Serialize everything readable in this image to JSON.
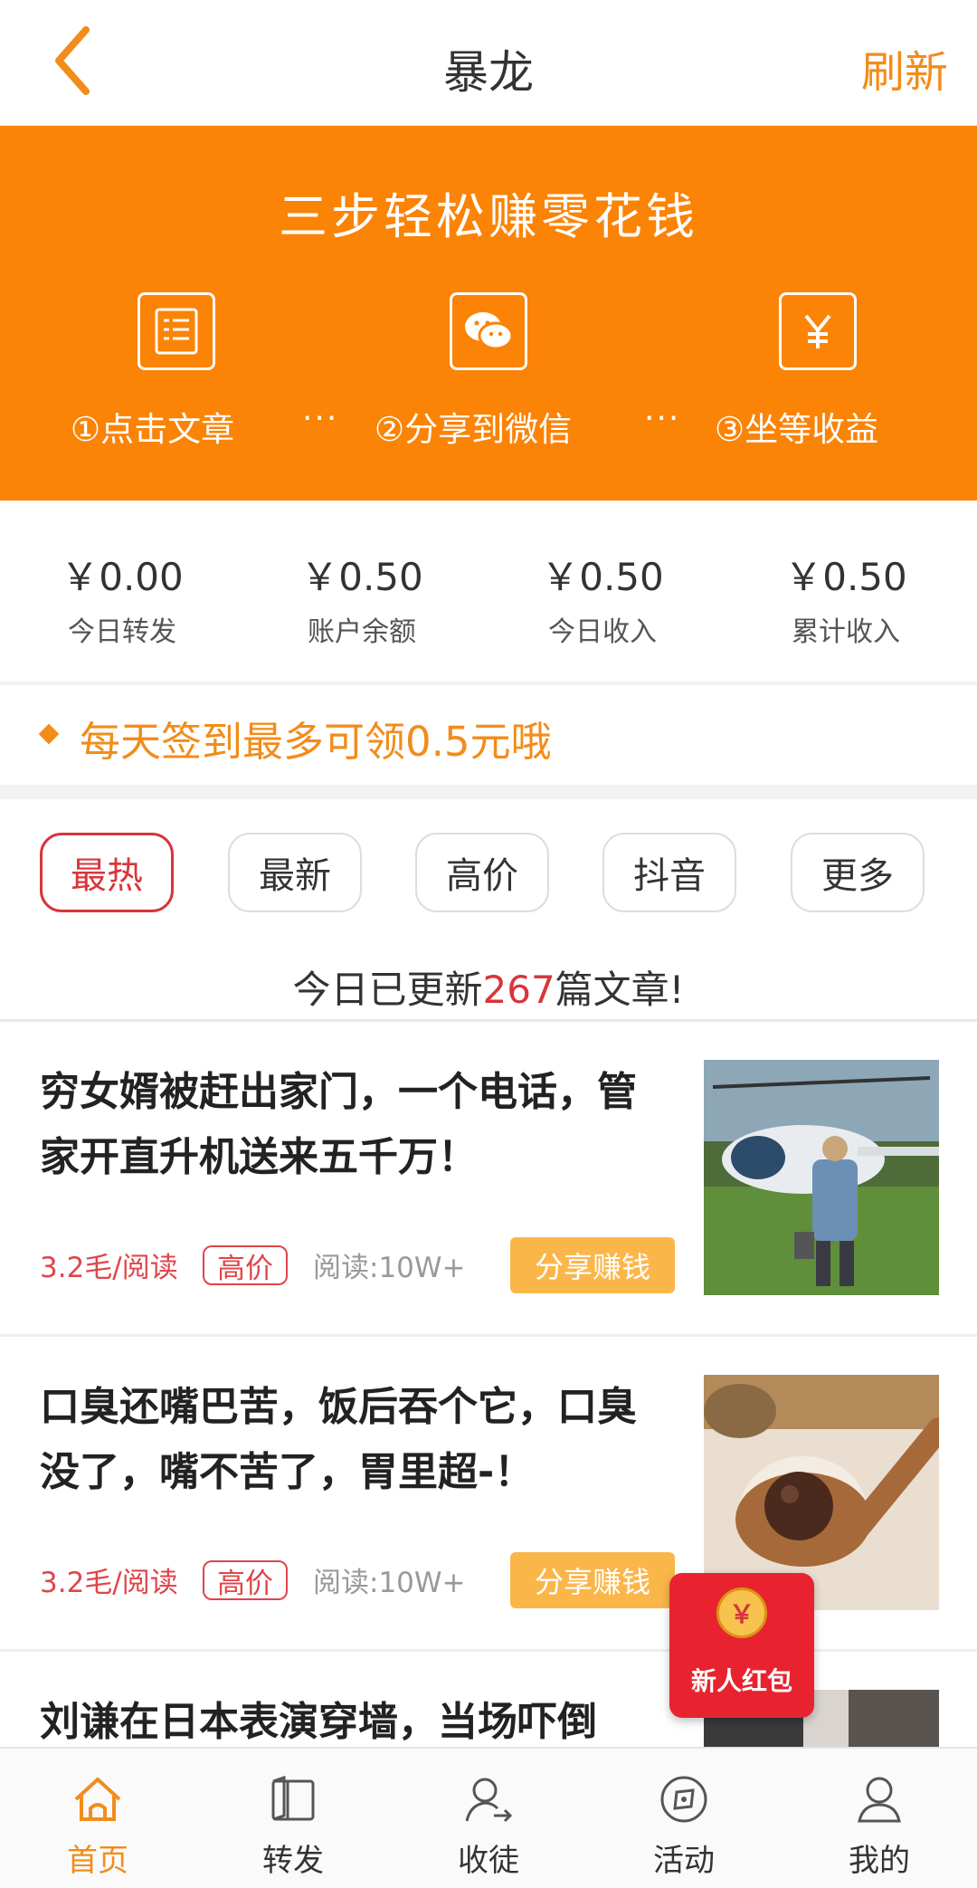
{
  "header": {
    "title": "暴龙",
    "refresh_label": "刷新"
  },
  "banner": {
    "title": "三步轻松赚零花钱",
    "steps": [
      {
        "label": "①点击文章",
        "icon": "article-list-icon"
      },
      {
        "label": "②分享到微信",
        "icon": "wechat-icon"
      },
      {
        "label": "③坐等收益",
        "icon": "yuan-icon"
      }
    ],
    "dots": "···"
  },
  "stats": [
    {
      "value": "￥0.00",
      "label": "今日转发"
    },
    {
      "value": "￥0.50",
      "label": "账户余额"
    },
    {
      "value": "￥0.50",
      "label": "今日收入"
    },
    {
      "value": "￥0.50",
      "label": "累计收入"
    }
  ],
  "tip": {
    "text": "每天签到最多可领0.5元哦"
  },
  "tabs": [
    "最热",
    "最新",
    "高价",
    "抖音",
    "更多"
  ],
  "active_tab": "最热",
  "update": {
    "prefix": "今日已更新",
    "count": "267",
    "suffix": "篇文章!"
  },
  "articles": [
    {
      "title": "穷女婿被赶出家门，一个电话，管家开直升机送来五千万！",
      "price": "3.2毛/阅读",
      "tag": "高价",
      "reads": "阅读:10W+",
      "share": "分享赚钱"
    },
    {
      "title": "口臭还嘴巴苦，饭后吞个它，口臭没了，嘴不苦了，胃里超-！",
      "price": "3.2毛/阅读",
      "tag": "高价",
      "reads": "阅读:10W+",
      "share": "分享赚钱"
    },
    {
      "title": "刘谦在日本表演穿墙，当场吓倒"
    }
  ],
  "redpack": {
    "label": "新人红包",
    "coin": "￥"
  },
  "nav": [
    {
      "label": "首页",
      "icon": "home-icon",
      "active": true
    },
    {
      "label": "转发",
      "icon": "book-icon"
    },
    {
      "label": "收徒",
      "icon": "user-add-icon"
    },
    {
      "label": "活动",
      "icon": "compass-icon"
    },
    {
      "label": "我的",
      "icon": "person-icon"
    }
  ],
  "colors": {
    "accent": "#fb8306",
    "highlight": "#d8353a",
    "share": "#fbb64a"
  }
}
